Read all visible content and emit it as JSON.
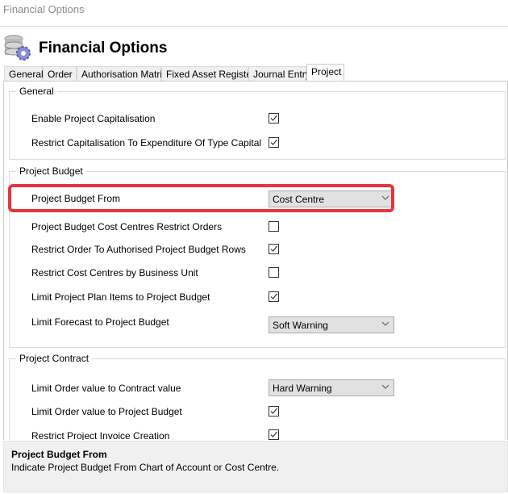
{
  "window": {
    "title": "Financial Options"
  },
  "header": {
    "title": "Financial Options",
    "icon": "database-gear-icon"
  },
  "tabs": [
    {
      "label": "General"
    },
    {
      "label": "Order"
    },
    {
      "label": "Authorisation Matrix"
    },
    {
      "label": "Fixed Asset Register"
    },
    {
      "label": "Journal Entry"
    },
    {
      "label": "Project",
      "active": true
    }
  ],
  "groups": {
    "general": {
      "title": "General",
      "rows": [
        {
          "label": "Enable Project Capitalisation",
          "checked": true
        },
        {
          "label": "Restrict Capitalisation To Expenditure Of Type Capital",
          "checked": true
        }
      ]
    },
    "budget": {
      "title": "Project Budget",
      "rows": [
        {
          "label": "Project Budget From",
          "value": "Cost Centre"
        },
        {
          "label": "Project Budget Cost Centres Restrict Orders",
          "checked": false
        },
        {
          "label": "Restrict Order To Authorised Project Budget Rows",
          "checked": true
        },
        {
          "label": "Restrict Cost Centres by Business Unit",
          "checked": false
        },
        {
          "label": "Limit Project Plan Items to Project Budget",
          "checked": true
        },
        {
          "label": "Limit Forecast to Project Budget",
          "value": "Soft Warning"
        }
      ]
    },
    "contract": {
      "title": "Project Contract",
      "rows": [
        {
          "label": "Limit Order value to Contract value",
          "value": "Hard Warning"
        },
        {
          "label": "Limit Order value to Project Budget",
          "checked": true
        },
        {
          "label": "Restrict Project Invoice Creation",
          "checked": true
        }
      ]
    }
  },
  "highlight_color": "#e8343a",
  "help": {
    "title": "Project Budget From",
    "description": "Indicate Project Budget From Chart of Account or Cost Centre."
  }
}
